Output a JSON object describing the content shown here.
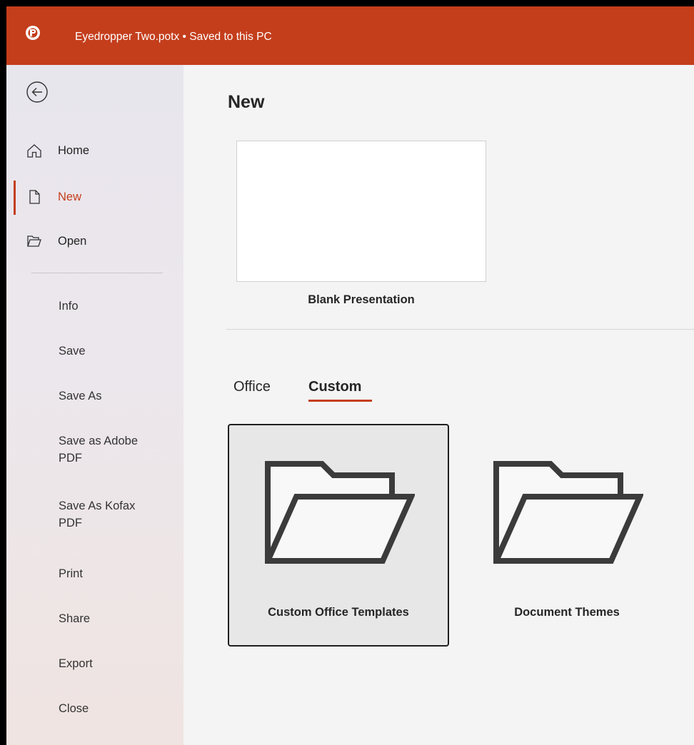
{
  "titlebar": {
    "app_icon": "powerpoint-icon",
    "title": "Eyedropper Two.potx • Saved to this PC"
  },
  "sidebar": {
    "back_icon": "back-arrow-icon",
    "primary": [
      {
        "label": "Home",
        "icon": "home-icon"
      },
      {
        "label": "New",
        "icon": "new-document-icon",
        "active": true
      },
      {
        "label": "Open",
        "icon": "open-folder-icon"
      }
    ],
    "secondary": [
      {
        "label": "Info"
      },
      {
        "label": "Save"
      },
      {
        "label": "Save As"
      },
      {
        "label": "Save as Adobe PDF"
      },
      {
        "label": "Save As Kofax PDF"
      },
      {
        "label": "Print"
      },
      {
        "label": "Share"
      },
      {
        "label": "Export"
      },
      {
        "label": "Close"
      }
    ]
  },
  "main": {
    "title": "New",
    "blank_template": {
      "label": "Blank Presentation"
    },
    "tabs": [
      {
        "label": "Office",
        "active": false
      },
      {
        "label": "Custom",
        "active": true
      }
    ],
    "folders": [
      {
        "label": "Custom Office Templates",
        "icon": "folder-icon",
        "selected": true
      },
      {
        "label": "Document Themes",
        "icon": "folder-icon",
        "selected": false
      }
    ]
  },
  "colors": {
    "accent": "#c43e1c",
    "titlebar": "#c43e1c",
    "sidebar": "#ebe8ee",
    "main_background": "#f4f4f4"
  }
}
